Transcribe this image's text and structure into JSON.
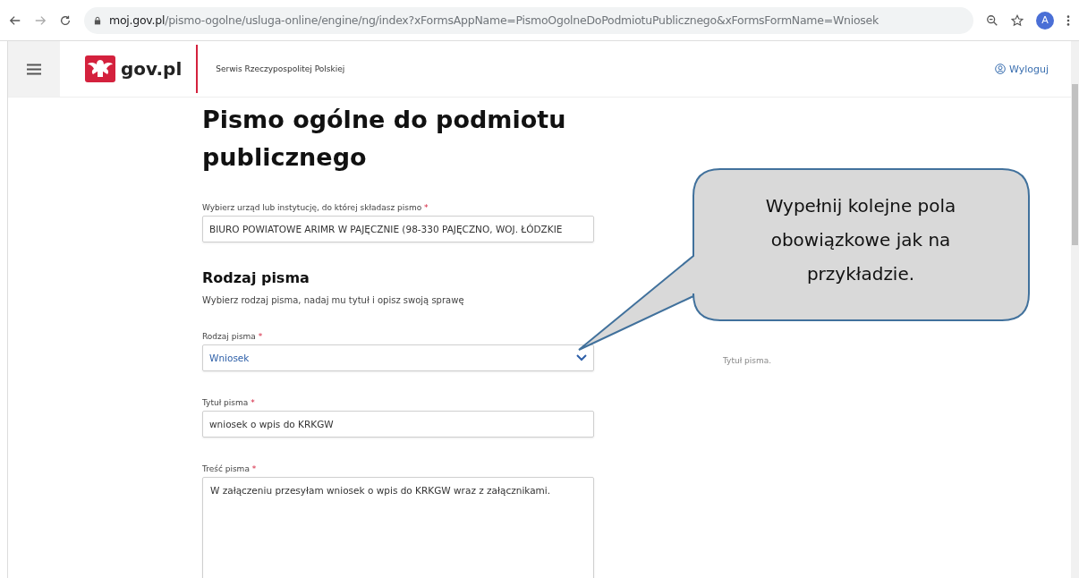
{
  "browser": {
    "url_host": "moj.gov.pl",
    "url_path": "/pismo-ogolne/usluga-online/engine/ng/index?xFormsAppName=PismoOgolneDoPodmiotuPublicznego&xFormsFormName=Wniosek",
    "avatar": "A"
  },
  "header": {
    "logo": "gov.pl",
    "tagline": "Serwis Rzeczypospolitej Polskiej",
    "logout": "Wyloguj"
  },
  "form": {
    "title": "Pismo ogólne do podmiotu publicznego",
    "office_field": {
      "label": "Wybierz urząd lub instytucję, do której składasz pismo",
      "required_mark": "*",
      "value": "BIURO POWIATOWE ARIMR W PAJĘCZNIE (98-330 PAJĘCZNO, WOJ. ŁÓDZKIE"
    },
    "section": {
      "heading": "Rodzaj pisma",
      "description": "Wybierz rodzaj pisma, nadaj mu tytuł i opisz swoją sprawę"
    },
    "fields": [
      {
        "kind": "select",
        "label": "Rodzaj pisma",
        "required_mark": "*",
        "value": "Wniosek",
        "hint": "Tytuł pisma."
      },
      {
        "kind": "input",
        "label": "Tytuł pisma",
        "required_mark": "*",
        "value": "wniosek o wpis do KRKGW"
      },
      {
        "kind": "textarea",
        "label": "Treść pisma",
        "required_mark": "*",
        "value": "W załączeniu przesyłam wniosek o wpis do KRKGW wraz z załącznikami."
      }
    ]
  },
  "callout": {
    "text": "Wypełnij kolejne pola obowiązkowe jak na przykładzie."
  }
}
